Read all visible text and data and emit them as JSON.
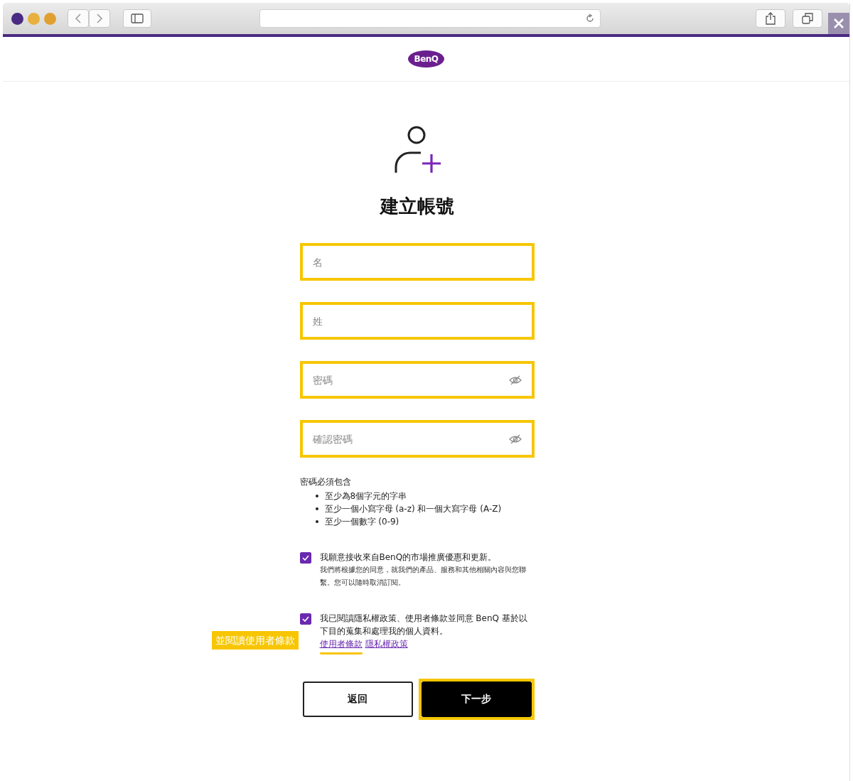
{
  "header": {
    "logo": "BenQ"
  },
  "title": "建立帳號",
  "fields": [
    {
      "placeholder": "名",
      "kind": "text",
      "highlighted": true
    },
    {
      "placeholder": "姓",
      "kind": "text",
      "highlighted": true
    },
    {
      "placeholder": "密碼",
      "kind": "password",
      "highlighted": true
    },
    {
      "placeholder": "確認密碼",
      "kind": "password",
      "highlighted": true
    }
  ],
  "requirements": {
    "heading": "密碼必須包含",
    "items": [
      "至少為8個字元的字串",
      "至少一個小寫字母 (a-z) 和一個大寫字母 (A-Z)",
      "至少一個數字 (0-9)"
    ]
  },
  "consents": [
    {
      "checked": true,
      "text": "我願意接收來自BenQ的市場推廣優惠和更新。",
      "note": "我們將根據您的同意，就我們的產品、服務和其他相關內容與您聯繫。您可以隨時取消訂閱。"
    },
    {
      "checked": true,
      "text": "我已閱讀隱私權政策、使用者條款並同意 BenQ 基於以下目的蒐集和處理我的個人資料。",
      "links": [
        {
          "label": "使用者條款",
          "highlighted": true
        },
        {
          "label": "隱私權政策",
          "highlighted": false
        }
      ]
    }
  ],
  "callout": "並閱讀使用者條款",
  "buttons": [
    {
      "label": "返回",
      "kind": "secondary",
      "highlighted": false
    },
    {
      "label": "下一步",
      "kind": "primary",
      "highlighted": true
    }
  ]
}
